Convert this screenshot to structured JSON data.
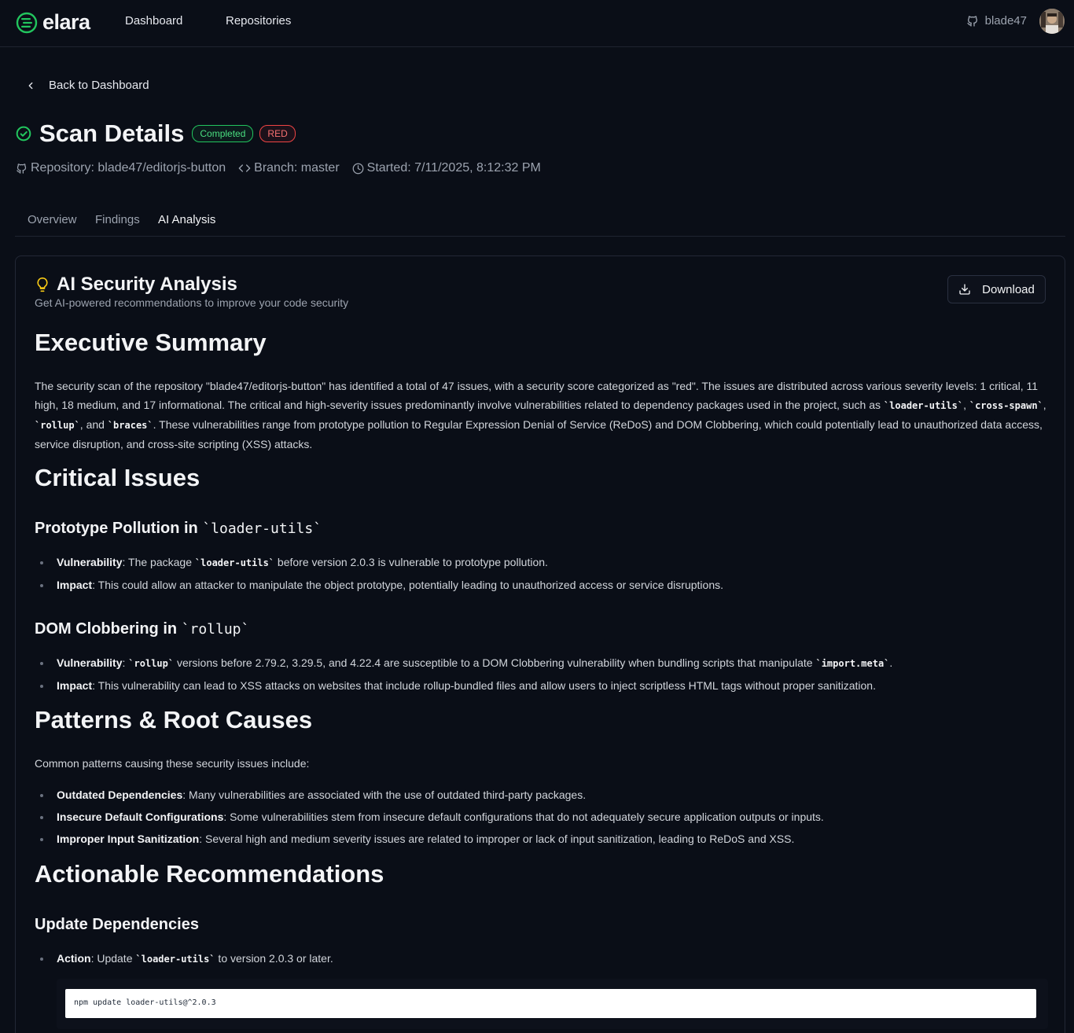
{
  "header": {
    "brand": "elara",
    "nav": [
      "Dashboard",
      "Repositories"
    ],
    "username": "blade47"
  },
  "back_label": "Back to Dashboard",
  "scan": {
    "title": "Scan Details",
    "status_badge": "Completed",
    "score_badge": "RED",
    "repository": "Repository: blade47/editorjs-button",
    "branch": "Branch: master",
    "started": "Started: 7/11/2025, 8:12:32 PM"
  },
  "tabs": [
    "Overview",
    "Findings",
    "AI Analysis"
  ],
  "analysis": {
    "title": "AI Security Analysis",
    "subtitle": "Get AI-powered recommendations to improve your code security",
    "download_label": "Download",
    "executive_summary": {
      "heading": "Executive Summary",
      "text_1": "The security scan of the repository \"blade47/editorjs-button\" has identified a total of 47 issues, with a security score categorized as \"red\". The issues are distributed across various severity levels: 1 critical, 11 high, 18 medium, and 17 informational. The critical and high-severity issues predominantly involve vulnerabilities related to dependency packages used in the project, such as ",
      "code_1": "`loader-utils`",
      "sep_1": ",",
      "code_2": "`cross-spawn`",
      "sep_2": ", ",
      "code_3": "`rollup`",
      "sep_3": ", and ",
      "code_4": "`braces`",
      "text_2": ". These vulnerabilities range from prototype pollution to Regular Expression Denial of Service (ReDoS) and DOM Clobbering, which could potentially lead to unauthorized data access, service disruption, and cross-site scripting (XSS) attacks."
    },
    "critical": {
      "heading": "Critical Issues",
      "issue_1": {
        "heading_text": "Prototype Pollution in ",
        "heading_code": "`loader-utils`",
        "vuln_label": "Vulnerability",
        "vuln_pre": ": The package ",
        "vuln_code": "`loader-utils`",
        "vuln_post": " before version 2.0.3 is vulnerable to prototype pollution.",
        "impact_label": "Impact",
        "impact_text": ": This could allow an attacker to manipulate the object prototype, potentially leading to unauthorized access or service disruptions."
      },
      "issue_2": {
        "heading_text": "DOM Clobbering in ",
        "heading_code": "`rollup`",
        "vuln_label": "Vulnerability",
        "vuln_pre": ": ",
        "vuln_code": "`rollup`",
        "vuln_mid": " versions before 2.79.2, 3.29.5, and 4.22.4 are susceptible to a DOM Clobbering vulnerability when bundling scripts that manipulate ",
        "vuln_code_2": "`import.meta`",
        "vuln_post": ".",
        "impact_label": "Impact",
        "impact_text": ": This vulnerability can lead to XSS attacks on websites that include rollup-bundled files and allow users to inject scriptless HTML tags without proper sanitization."
      }
    },
    "patterns": {
      "heading": "Patterns & Root Causes",
      "intro": "Common patterns causing these security issues include:",
      "items": [
        {
          "label": "Outdated Dependencies",
          "text": ": Many vulnerabilities are associated with the use of outdated third-party packages."
        },
        {
          "label": "Insecure Default Configurations",
          "text": ": Some vulnerabilities stem from insecure default configurations that do not adequately secure application outputs or inputs."
        },
        {
          "label": "Improper Input Sanitization",
          "text": ": Several high and medium severity issues are related to improper or lack of input sanitization, leading to ReDoS and XSS."
        }
      ]
    },
    "recommendations": {
      "heading": "Actionable Recommendations",
      "sub_heading": "Update Dependencies",
      "action_label": "Action",
      "action_pre": ": Update ",
      "action_code": "`loader-utils`",
      "action_post": " to version 2.0.3 or later.",
      "command": "npm update loader-utils@^2.0.3"
    }
  },
  "colors": {
    "background": "#0a0e17",
    "accent_green": "#22c55e",
    "accent_red": "#ef4444",
    "bulb_yellow": "#facc15"
  }
}
